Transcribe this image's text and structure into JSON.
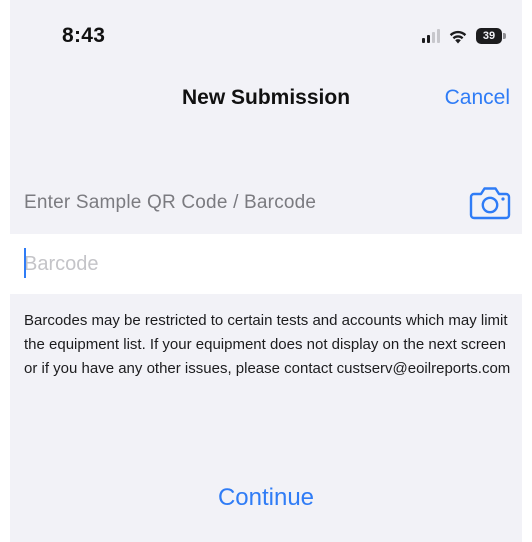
{
  "status_bar": {
    "time": "8:43",
    "battery_level": "39",
    "signal_bars_active": 2,
    "signal_bars_total": 4
  },
  "nav": {
    "title": "New Submission",
    "cancel_label": "Cancel"
  },
  "form": {
    "section_label": "Enter Sample QR Code / Barcode",
    "barcode_value": "",
    "barcode_placeholder": "Barcode",
    "camera_icon": "camera-icon",
    "help_text": "Barcodes may be restricted to certain tests and accounts which may limit the equipment list. If your equipment does not display on the next screen or if you have any other issues, please contact custserv@eoilreports.com",
    "continue_label": "Continue"
  },
  "colors": {
    "accent": "#2f7cf6",
    "background": "#f2f2f7",
    "secondary_text": "#7b7b80"
  }
}
